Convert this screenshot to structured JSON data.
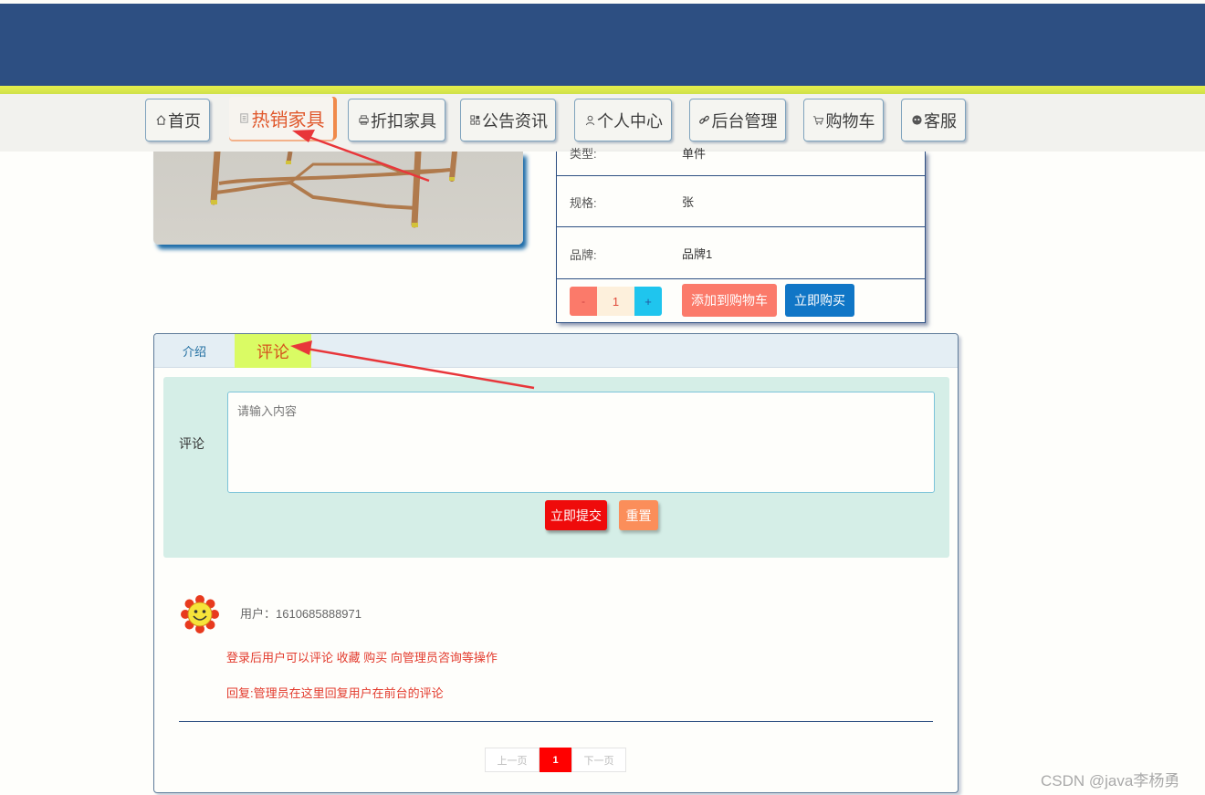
{
  "nav": {
    "items": [
      {
        "label": "首页",
        "icon": "home-icon"
      },
      {
        "label": "热销家具",
        "icon": "document-icon",
        "active": true
      },
      {
        "label": "折扣家具",
        "icon": "printer-icon"
      },
      {
        "label": "公告资讯",
        "icon": "grid-icon"
      },
      {
        "label": "个人中心",
        "icon": "user-icon"
      },
      {
        "label": "后台管理",
        "icon": "link-icon"
      },
      {
        "label": "购物车",
        "icon": "cart-icon"
      },
      {
        "label": "客服",
        "icon": "chat-icon"
      }
    ]
  },
  "product": {
    "rows": [
      {
        "key": "类型:",
        "value": "单件"
      },
      {
        "key": "规格:",
        "value": "张"
      },
      {
        "key": "品牌:",
        "value": "品牌1"
      }
    ],
    "quantity": {
      "minus": "-",
      "value": "1",
      "plus": "+"
    },
    "add_to_cart": "添加到购物车",
    "buy_now": "立即购买"
  },
  "tabs": {
    "intro": "介绍",
    "comment": "评论"
  },
  "comment_form": {
    "label": "评论",
    "placeholder": "请输入内容",
    "submit": "立即提交",
    "reset": "重置"
  },
  "comments": [
    {
      "user": "用户：1610685888971",
      "text": "登录后用户可以评论 收藏 购买 向管理员咨询等操作",
      "reply": "回复:管理员在这里回复用户在前台的评论"
    }
  ],
  "pagination": {
    "prev": "上一页",
    "current": "1",
    "next": "下一页"
  },
  "watermark": "CSDN @java李杨勇",
  "colors": {
    "header": "#2d4f82",
    "accent_yellow": "#dafb64",
    "active_nav": "#e0582c",
    "submit": "#ef0b0b",
    "buy": "#1076c6",
    "add_cart": "#fb7a6a",
    "annotation_arrow": "#e8363a"
  }
}
